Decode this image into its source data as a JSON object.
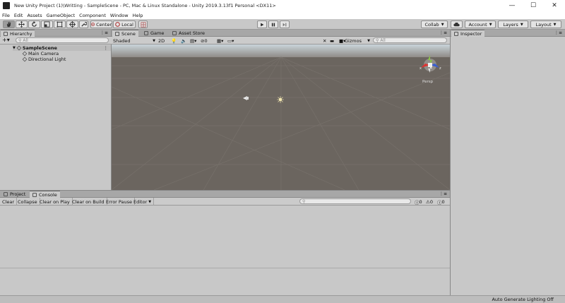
{
  "window": {
    "title": "New Unity Project (1)\\Writting - SampleScene - PC, Mac & Linux Standalone - Unity 2019.3.13f1 Personal <DX11>",
    "minimize": "—",
    "maximize": "☐",
    "close": "✕"
  },
  "menu": [
    "File",
    "Edit",
    "Assets",
    "GameObject",
    "Component",
    "Window",
    "Help"
  ],
  "toolbar": {
    "center_label": "Center",
    "local_label": "Local",
    "collab_label": "Collab",
    "account_label": "Account",
    "layers_label": "Layers",
    "layout_label": "Layout"
  },
  "hierarchy": {
    "tab_label": "Hierarchy",
    "search_placeholder": "All",
    "scene_name": "SampleScene",
    "items": [
      "Main Camera",
      "Directional Light"
    ]
  },
  "scene": {
    "tabs": [
      "Scene",
      "Game",
      "Asset Store"
    ],
    "shading_mode": "Shaded",
    "mode_2d": "2D",
    "hidden_count": "0",
    "gizmos_label": "Gizmos",
    "search_placeholder": "All",
    "persp_label": "Persp",
    "axis_x": "x",
    "axis_z": "z",
    "sky_color": "#c9d4da",
    "ground_color": "#6b655f"
  },
  "bottom": {
    "tabs": [
      "Project",
      "Console"
    ],
    "console_buttons": [
      "Clear",
      "Collapse",
      "Clear on Play",
      "Clear on Build",
      "Error Pause",
      "Editor"
    ],
    "counts": {
      "info": "0",
      "warning": "0",
      "error": "0"
    }
  },
  "inspector": {
    "tab_label": "Inspector"
  },
  "status": {
    "text": "Auto Generate Lighting Off"
  }
}
